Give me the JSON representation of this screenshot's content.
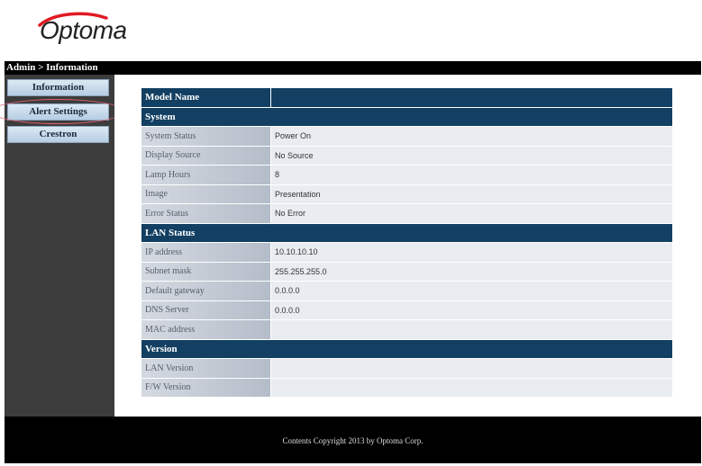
{
  "brand": {
    "logo_text": "Optoma",
    "accent": "#e01a22"
  },
  "breadcrumb": "Admin > Information",
  "sidebar": {
    "items": [
      {
        "label": "Information"
      },
      {
        "label": "Alert Settings"
      },
      {
        "label": "Crestron"
      }
    ]
  },
  "table": {
    "header": {
      "label": "Model Name",
      "value": ""
    },
    "sections": [
      {
        "title": "System",
        "rows": [
          {
            "label": "System Status",
            "value": "Power On"
          },
          {
            "label": "Display Source",
            "value": "No Source"
          },
          {
            "label": "Lamp Hours",
            "value": "8"
          },
          {
            "label": "Image",
            "value": "Presentation"
          },
          {
            "label": "Error Status",
            "value": "No Error"
          }
        ]
      },
      {
        "title": "LAN Status",
        "rows": [
          {
            "label": "IP address",
            "value": "10.10.10.10"
          },
          {
            "label": "Subnet mask",
            "value": "255.255.255.0"
          },
          {
            "label": "Default gateway",
            "value": "0.0.0.0"
          },
          {
            "label": "DNS Server",
            "value": "0.0.0.0"
          },
          {
            "label": "MAC address",
            "value": ""
          }
        ]
      },
      {
        "title": "Version",
        "rows": [
          {
            "label": "LAN Version",
            "value": ""
          },
          {
            "label": "F/W Version",
            "value": ""
          }
        ]
      }
    ]
  },
  "footer": "Contents Copyright 2013 by Optoma Corp."
}
